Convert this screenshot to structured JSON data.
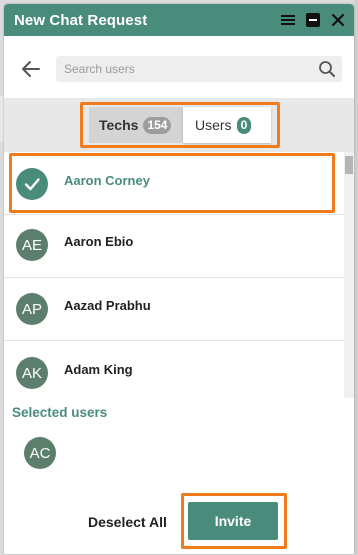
{
  "window": {
    "title": "New Chat Request"
  },
  "search": {
    "placeholder": "Search users"
  },
  "tabs": [
    {
      "label": "Techs",
      "count": "154"
    },
    {
      "label": "Users",
      "count": "0"
    }
  ],
  "users": [
    {
      "name": "Aaron Corney",
      "initials": "",
      "selected": true
    },
    {
      "name": "Aaron Ebio",
      "initials": "AE"
    },
    {
      "name": "Aazad Prabhu",
      "initials": "AP"
    },
    {
      "name": "Adam King",
      "initials": "AK"
    }
  ],
  "selected": {
    "title": "Selected users",
    "avatars": [
      {
        "initials": "AC"
      }
    ]
  },
  "footer": {
    "deselect_label": "Deselect All",
    "invite_label": "Invite"
  },
  "colors": {
    "accent": "#4a8c7c",
    "highlight": "#f07c1e",
    "avatar": "#5c7f6d"
  }
}
